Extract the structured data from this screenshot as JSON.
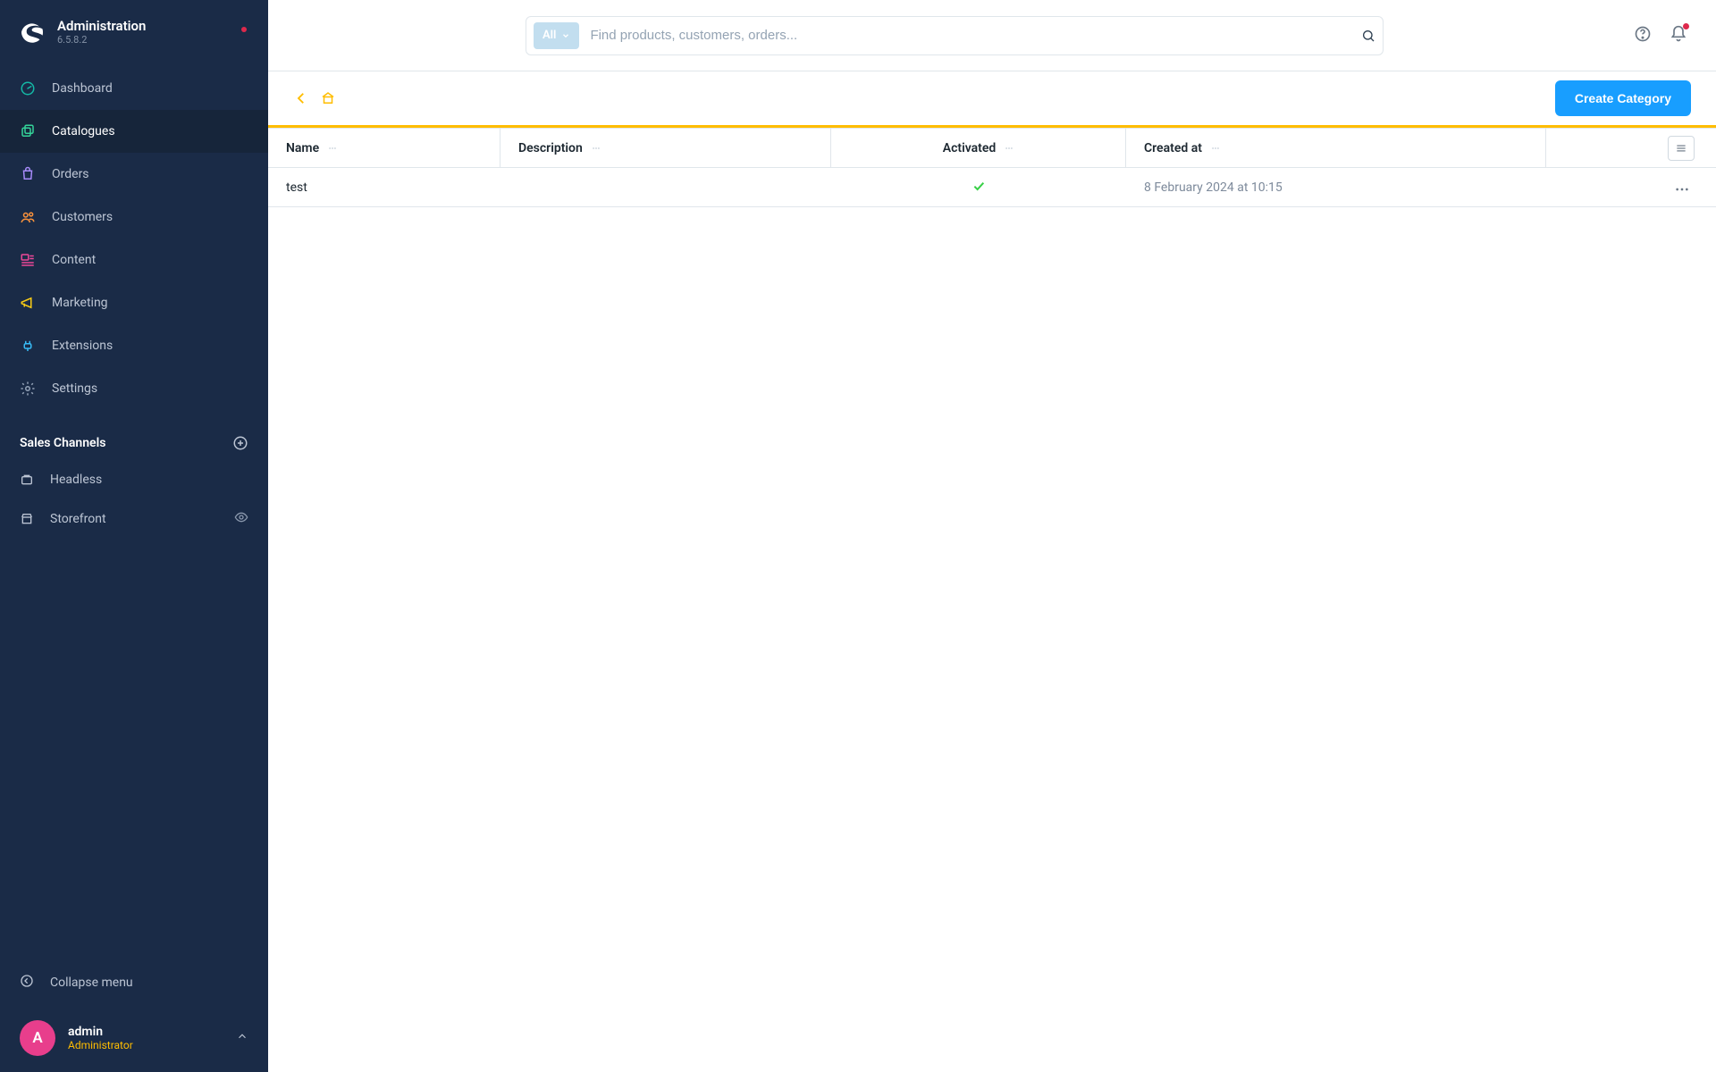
{
  "app": {
    "title": "Administration",
    "version": "6.5.8.2"
  },
  "nav": {
    "items": [
      {
        "label": "Dashboard"
      },
      {
        "label": "Catalogues"
      },
      {
        "label": "Orders"
      },
      {
        "label": "Customers"
      },
      {
        "label": "Content"
      },
      {
        "label": "Marketing"
      },
      {
        "label": "Extensions"
      },
      {
        "label": "Settings"
      }
    ]
  },
  "sales_channels": {
    "heading": "Sales Channels",
    "items": [
      {
        "label": "Headless"
      },
      {
        "label": "Storefront"
      }
    ]
  },
  "sidebar": {
    "collapse_label": "Collapse menu"
  },
  "user": {
    "initial": "A",
    "name": "admin",
    "role": "Administrator"
  },
  "search": {
    "type_label": "All",
    "placeholder": "Find products, customers, orders..."
  },
  "content": {
    "create_button": "Create Category"
  },
  "table": {
    "columns": {
      "name": "Name",
      "description": "Description",
      "activated": "Activated",
      "created_at": "Created at"
    },
    "rows": [
      {
        "name": "test",
        "description": "",
        "activated": true,
        "created_at": "8 February 2024 at 10:15"
      }
    ]
  }
}
